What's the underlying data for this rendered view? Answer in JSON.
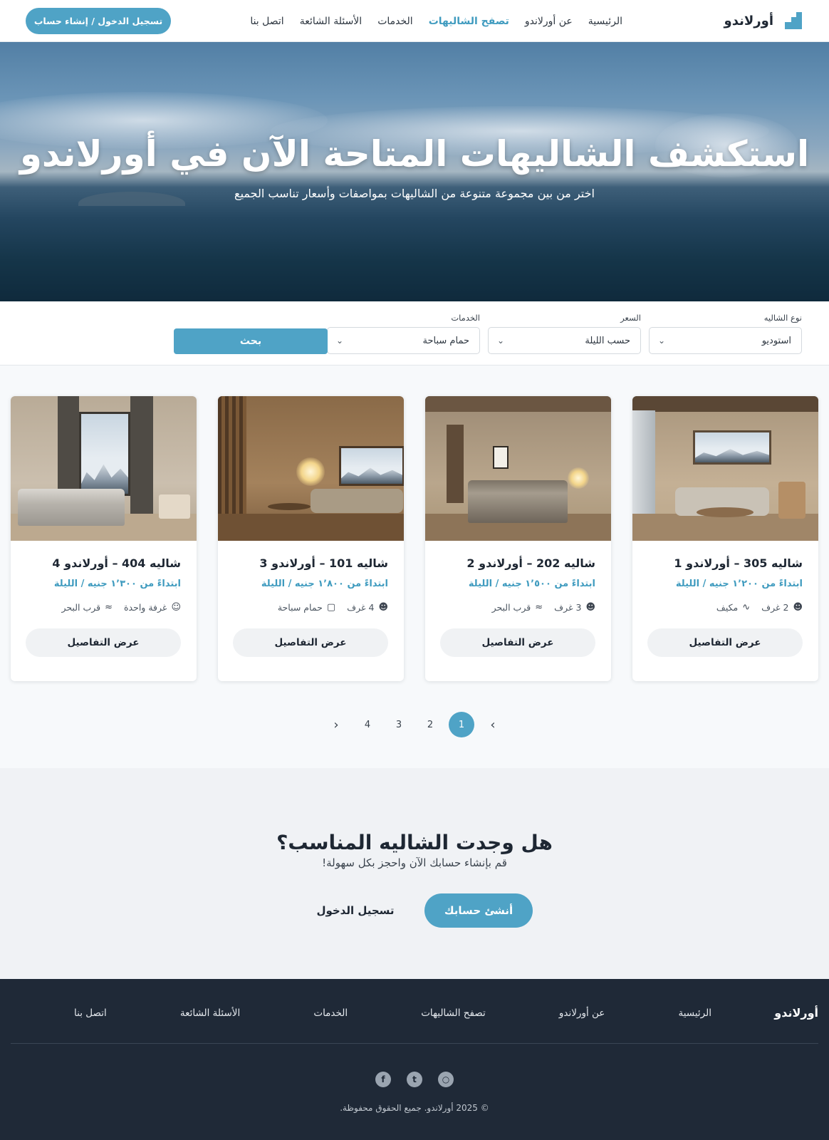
{
  "header": {
    "brand": "أورلاندو",
    "nav": [
      "الرئيسية",
      "عن أورلاندو",
      "تصفح الشاليهات",
      "الخدمات",
      "الأسئلة الشائعة",
      "اتصل بنا"
    ],
    "active_nav": "تصفح الشاليهات",
    "login_button": "تسجيل الدخول / إنشاء حساب"
  },
  "hero": {
    "title": "استكشف الشاليهات المتاحة الآن في أورلاندو",
    "subtitle": "اختر من بين مجموعة متنوعة من الشاليهات بمواصفات وأسعار تناسب الجميع"
  },
  "search": {
    "type_label": "نوع الشاليه",
    "type_value": "استوديو",
    "price_label": "السعر",
    "price_value": "حسب الليلة",
    "services_label": "الخدمات",
    "services_value": "حمام سباحة",
    "button": "بحث"
  },
  "cards": [
    {
      "title": "شاليه 305 – أورلاندو 1",
      "price": "ابتداءً من ١٬٢٠٠ جنيه / الليلة",
      "feature1_icon": "users-icon",
      "feature1": "2 غرف",
      "feature2_icon": "activity-icon",
      "feature2": "مكيف",
      "button": "عرض التفاصيل"
    },
    {
      "title": "شاليه 202 – أورلاندو 2",
      "price": "ابتداءً من ١٬٥٠٠ جنيه / الليلة",
      "feature1_icon": "users-icon",
      "feature1": "3 غرف",
      "feature2_icon": "waves-icon",
      "feature2": "قرب البحر",
      "button": "عرض التفاصيل"
    },
    {
      "title": "شاليه 101 – أورلاندو 3",
      "price": "ابتداءً من ١٬٨٠٠ جنيه / الليلة",
      "feature1_icon": "users-icon",
      "feature1": "4 غرف",
      "feature2_icon": "lock-icon",
      "feature2": "حمام سباحة",
      "button": "عرض التفاصيل"
    },
    {
      "title": "شاليه 404 – أورلاندو 4",
      "price": "ابتداءً من ١٬٣٠٠ جنيه / الليلة",
      "feature1_icon": "user-icon",
      "feature1": "غرفة واحدة",
      "feature2_icon": "waves-icon",
      "feature2": "قرب البحر",
      "button": "عرض التفاصيل"
    }
  ],
  "pagination": {
    "pages": [
      "1",
      "2",
      "3",
      "4"
    ],
    "current": "1"
  },
  "cta": {
    "title": "هل وجدت الشاليه المناسب؟",
    "subtitle": "قم بإنشاء حسابك الآن واحجز بكل سهولة!",
    "primary": "أنشئ حسابك",
    "secondary": "تسجيل الدخول"
  },
  "footer": {
    "brand": "أورلاندو",
    "links": [
      "الرئيسية",
      "عن أورلاندو",
      "تصفح الشاليهات",
      "الخدمات",
      "الأسئلة الشائعة",
      "اتصل بنا"
    ],
    "socials": [
      "instagram-icon",
      "twitter-icon",
      "facebook-icon"
    ],
    "copyright": "© 2025 أورلاندو. جميع الحقوق محفوظة."
  },
  "colors": {
    "accent": "#4fa3c6",
    "footer_bg": "#1f2937"
  }
}
